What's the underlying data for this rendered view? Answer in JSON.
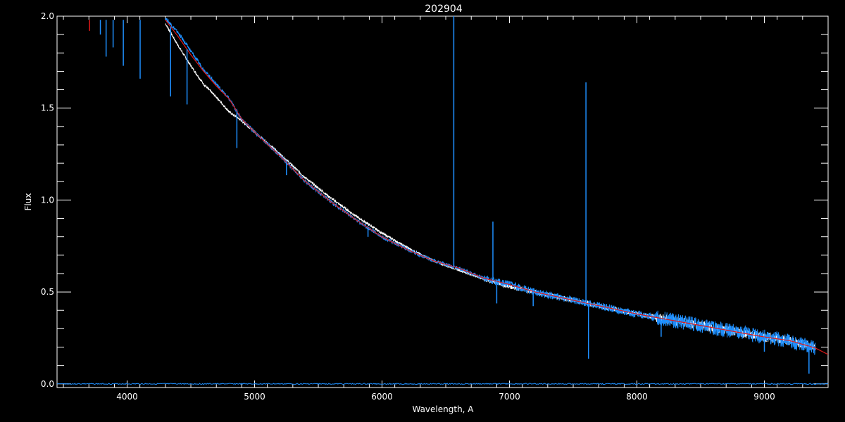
{
  "chart_data": {
    "type": "line",
    "title": "202904",
    "xlabel": "Wavelength, A",
    "ylabel": "Flux",
    "xlim": [
      3450,
      9500
    ],
    "ylim": [
      -0.02,
      2.0
    ],
    "x_ticks": [
      4000,
      5000,
      6000,
      7000,
      8000,
      9000
    ],
    "x_tick_labels": [
      "4000",
      "5000",
      "6000",
      "7000",
      "8000",
      "9000"
    ],
    "y_ticks": [
      0.0,
      0.5,
      1.0,
      1.5,
      2.0
    ],
    "y_tick_labels": [
      "0.0",
      "0.5",
      "1.0",
      "1.5",
      "2.0"
    ],
    "grid": false,
    "legend": "none",
    "colors": {
      "background": "#000000",
      "axes": "#ffffff",
      "spectrum": "#ffffff",
      "overlay": "#1e8fff",
      "model": "#e01818",
      "model_alt": "#7a3aa0"
    },
    "continuum": {
      "x": [
        4300,
        4400,
        4500,
        4600,
        4700,
        4800,
        4900,
        5000,
        5200,
        5400,
        5600,
        5800,
        6000,
        6200,
        6400,
        6600,
        6800,
        7000,
        7200,
        7400,
        7600,
        7800,
        8000,
        8200,
        8400,
        8600,
        8800,
        9000,
        9200,
        9400,
        9500
      ],
      "y": [
        1.98,
        1.89,
        1.79,
        1.7,
        1.62,
        1.55,
        1.44,
        1.37,
        1.24,
        1.1,
        0.99,
        0.89,
        0.8,
        0.73,
        0.67,
        0.63,
        0.575,
        0.54,
        0.5,
        0.47,
        0.44,
        0.41,
        0.38,
        0.355,
        0.33,
        0.305,
        0.28,
        0.255,
        0.235,
        0.195,
        0.16
      ]
    },
    "series": [
      {
        "color": "#ffffff",
        "x": [
          4300,
          4400,
          4500,
          4600,
          4700,
          4800,
          4900,
          5000,
          5200,
          5400,
          5600,
          5800,
          6000,
          6200,
          6400,
          6600,
          6800,
          7000,
          7200,
          7400,
          7600,
          7800,
          8000,
          8200,
          8400,
          8600,
          8800,
          9000,
          9200,
          9400
        ],
        "y": [
          1.96,
          1.84,
          1.73,
          1.63,
          1.56,
          1.48,
          1.43,
          1.37,
          1.25,
          1.12,
          1.01,
          0.91,
          0.82,
          0.74,
          0.67,
          0.62,
          0.57,
          0.53,
          0.5,
          0.47,
          0.44,
          0.41,
          0.38,
          0.355,
          0.33,
          0.305,
          0.28,
          0.255,
          0.235,
          0.2
        ]
      },
      {
        "color": "#1e8fff",
        "x": [
          4300,
          4400,
          4500,
          4600,
          4700,
          4800,
          4900,
          5000,
          5200,
          5400,
          5600,
          5800,
          6000,
          6200,
          6400,
          6600,
          6800,
          7000,
          7200,
          7400,
          7600,
          7800,
          8000,
          8200,
          8400,
          8600,
          8800,
          9000,
          9200,
          9400
        ],
        "y": [
          1.99,
          1.91,
          1.81,
          1.71,
          1.63,
          1.55,
          1.44,
          1.37,
          1.24,
          1.1,
          0.99,
          0.89,
          0.8,
          0.73,
          0.67,
          0.63,
          0.575,
          0.54,
          0.5,
          0.47,
          0.44,
          0.41,
          0.38,
          0.355,
          0.33,
          0.305,
          0.28,
          0.255,
          0.235,
          0.195
        ]
      },
      {
        "color": "#e01818",
        "x": [
          4300,
          4400,
          4500,
          4600,
          4700,
          4800,
          4900,
          5000,
          5200,
          5400,
          5600,
          5800,
          6000,
          6200,
          6400,
          6600,
          6800,
          7000,
          7200,
          7400,
          7600,
          7800,
          8000,
          8200,
          8400,
          8600,
          8800,
          9000,
          9200,
          9400,
          9500
        ],
        "y": [
          1.98,
          1.89,
          1.79,
          1.7,
          1.62,
          1.55,
          1.44,
          1.37,
          1.24,
          1.1,
          0.99,
          0.89,
          0.8,
          0.73,
          0.67,
          0.63,
          0.575,
          0.54,
          0.5,
          0.47,
          0.44,
          0.41,
          0.38,
          0.355,
          0.33,
          0.305,
          0.28,
          0.255,
          0.235,
          0.195,
          0.16
        ]
      }
    ],
    "features": [
      {
        "x": 3705,
        "depth": 0.06,
        "color": "#e01818"
      },
      {
        "x": 3790,
        "depth": 0.08,
        "color": "#1e8fff"
      },
      {
        "x": 3835,
        "depth": 0.2,
        "color": "#1e8fff"
      },
      {
        "x": 3890,
        "depth": 0.15,
        "color": "#1e8fff"
      },
      {
        "x": 3970,
        "depth": 0.25,
        "color": "#1e8fff"
      },
      {
        "x": 4102,
        "depth": 0.32,
        "color": "#1e8fff"
      },
      {
        "x": 4341,
        "depth": 0.38,
        "color": "#1e8fff"
      },
      {
        "x": 4470,
        "depth": 0.3,
        "color": "#1e8fff"
      },
      {
        "x": 4861,
        "depth": 0.2,
        "color": "#1e8fff"
      },
      {
        "x": 5250,
        "depth": 0.07,
        "color": "#1e8fff"
      },
      {
        "x": 5890,
        "depth": 0.05,
        "color": "#1e8fff"
      },
      {
        "x": 6563,
        "depth": -1.4,
        "color": "#1e8fff"
      },
      {
        "x": 6870,
        "depth": -0.32,
        "color": "#1e8fff"
      },
      {
        "x": 6900,
        "depth": 0.12,
        "color": "#1e8fff"
      },
      {
        "x": 7186,
        "depth": 0.08,
        "color": "#1e8fff"
      },
      {
        "x": 7600,
        "depth": -1.2,
        "color": "#1e8fff"
      },
      {
        "x": 7620,
        "depth": 0.3,
        "color": "#1e8fff"
      },
      {
        "x": 8190,
        "depth": 0.1,
        "color": "#1e8fff"
      },
      {
        "x": 9000,
        "depth": 0.08,
        "color": "#1e8fff"
      },
      {
        "x": 9350,
        "depth": 0.15,
        "color": "#1e8fff"
      }
    ]
  }
}
